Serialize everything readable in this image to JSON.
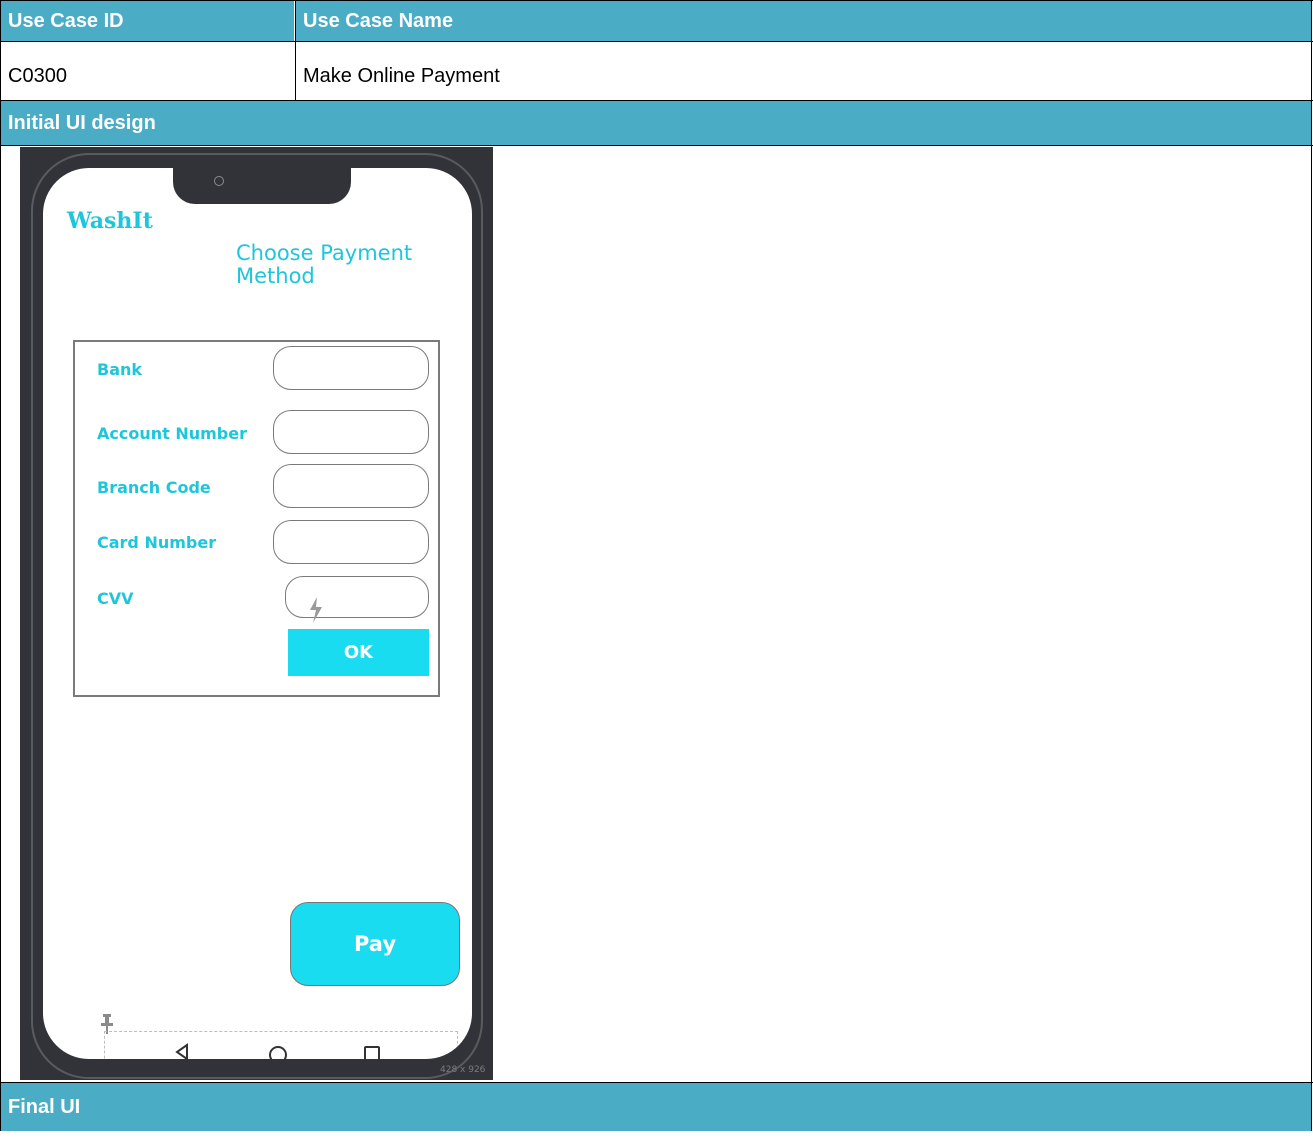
{
  "table": {
    "header_id": "Use Case ID",
    "header_name": "Use Case Name",
    "use_case_id": "C0300",
    "use_case_name": "Make Online Payment",
    "section_initial": "Initial UI design",
    "section_final": "Final UI"
  },
  "mockup": {
    "brand": "WashIt",
    "title": "Choose Payment Method",
    "fields": {
      "bank_label": "Bank",
      "account_label": "Account Number",
      "branch_label": "Branch Code",
      "card_label": "Card Number",
      "cvv_label": "CVV"
    },
    "ok_label": "OK",
    "pay_label": "Pay",
    "dimensions": "428 x 926"
  },
  "colors": {
    "header_bg": "#4bacc6",
    "accent": "#1adcf0",
    "frame": "#323338"
  },
  "icons": [
    "back-triangle-icon",
    "home-circle-icon",
    "recent-square-icon",
    "pin-icon",
    "lightning-icon",
    "camera-icon"
  ]
}
